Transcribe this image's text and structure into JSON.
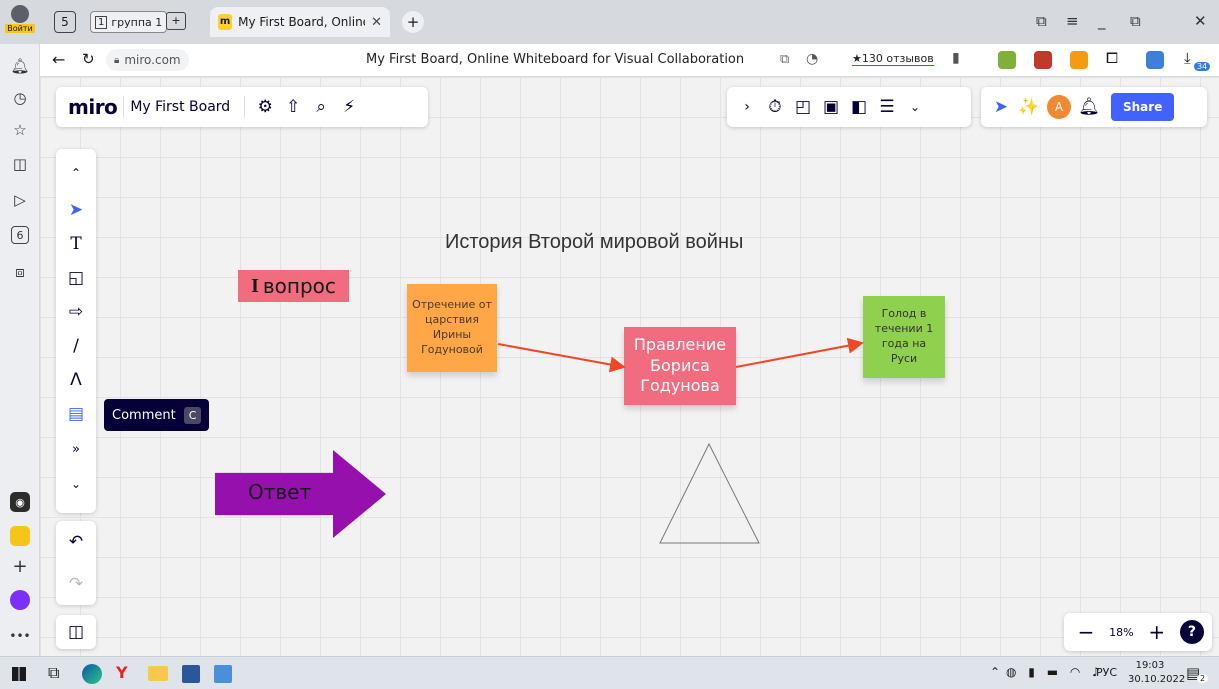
{
  "browser": {
    "login_label": "Войти",
    "tab_group_label": "группа 1",
    "tab_group_count": "1",
    "tab_count": "5",
    "active_tab_title": "My First Board, Online V",
    "url": "miro.com",
    "page_title": "My First Board, Online Whiteboard for Visual Collaboration",
    "reviews": "★130 отзывов",
    "ext_badge": "34"
  },
  "miro": {
    "logo": "miro",
    "board_name": "My First Board",
    "share_label": "Share",
    "avatar_letter": "A",
    "zoom": "18%",
    "help": "?",
    "tooltip_label": "Comment",
    "tooltip_key": "C"
  },
  "board": {
    "title": "История Второй мировой войны",
    "question_label": "вопрос",
    "question_roman": "I",
    "answer_label": "Ответ",
    "notes": {
      "orange": "Отречение от царствия Ирины Годуновой",
      "pink": "Правление Бориса Годунова",
      "green": "Голод в течении 1 года на Руси"
    }
  },
  "colors": {
    "orange": "#ffa646",
    "pink": "#f16c7f",
    "green": "#8fd14f",
    "purple": "#9510ac",
    "connector": "#f24726",
    "share": "#4262ff"
  },
  "taskbar": {
    "lang": "РУС",
    "time": "19:03",
    "date": "30.10.2022",
    "notif_count": "2"
  }
}
